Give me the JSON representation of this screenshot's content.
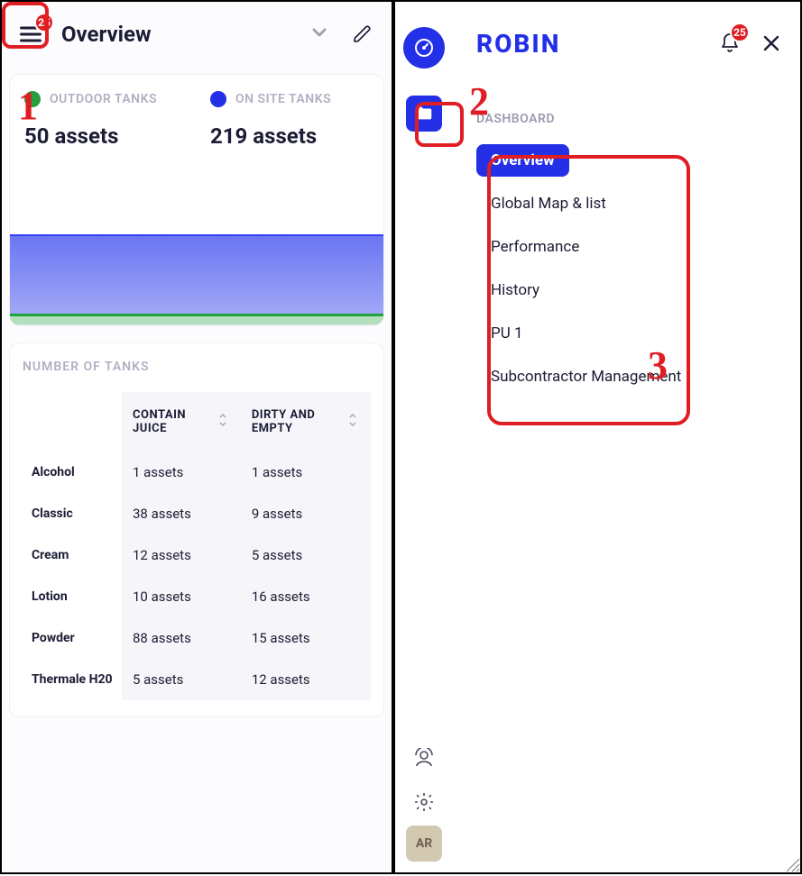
{
  "annotations": {
    "a1": "1",
    "a2": "2",
    "a3": "3"
  },
  "left": {
    "menu_badge": "25",
    "title": "Overview",
    "stats": {
      "outdoor": {
        "label": "OUTDOOR TANKS",
        "value": "50 assets"
      },
      "onsite": {
        "label": "ON SITE TANKS",
        "value": "219 assets"
      }
    },
    "table": {
      "title": "NUMBER OF TANKS",
      "columns": {
        "col1": "CONTAIN JUICE",
        "col2": "DIRTY AND EMPTY"
      },
      "rows": [
        {
          "name": "Alcohol",
          "c1": "1 assets",
          "c2": "1 assets"
        },
        {
          "name": "Classic",
          "c1": "38 assets",
          "c2": "9 assets"
        },
        {
          "name": "Cream",
          "c1": "12 assets",
          "c2": "5 assets"
        },
        {
          "name": "Lotion",
          "c1": "10 assets",
          "c2": "16 assets"
        },
        {
          "name": "Powder",
          "c1": "88 assets",
          "c2": "15 assets"
        },
        {
          "name": "Thermale H20",
          "c1": "5 assets",
          "c2": "12 assets"
        }
      ]
    }
  },
  "right": {
    "brand": "ROBIN",
    "bell_badge": "25",
    "section_label": "DASHBOARD",
    "menu": [
      {
        "label": "Overview",
        "active": true
      },
      {
        "label": "Global Map & list",
        "active": false
      },
      {
        "label": "Performance",
        "active": false
      },
      {
        "label": "History",
        "active": false
      },
      {
        "label": "PU 1",
        "active": false
      },
      {
        "label": "Subcontractor Management",
        "active": false
      }
    ],
    "avatar": "AR"
  }
}
